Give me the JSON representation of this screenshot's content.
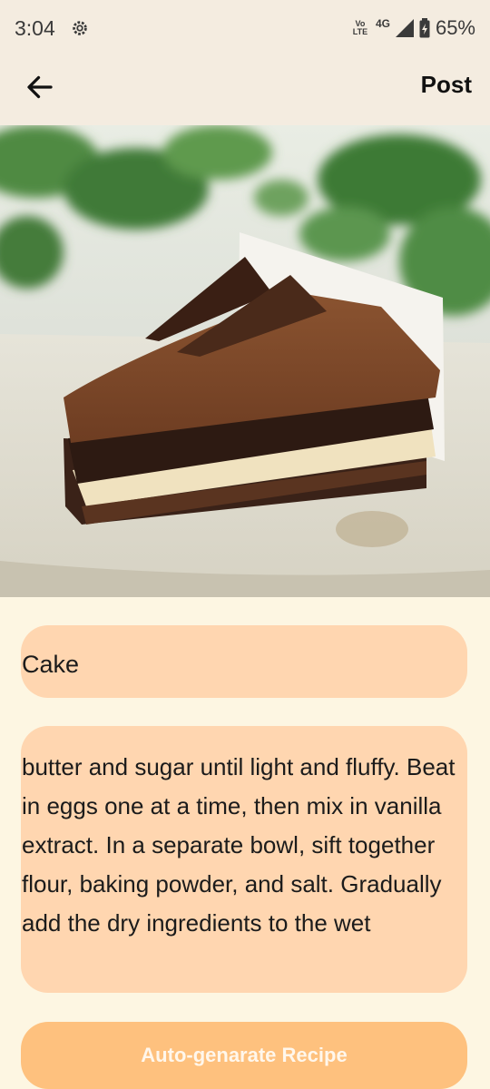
{
  "status_bar": {
    "time": "3:04",
    "network": "4G",
    "volte": "Vo LTE",
    "battery": "65%"
  },
  "top_bar": {
    "post_label": "Post"
  },
  "form": {
    "title_value": "Cake",
    "recipe_value": "butter and sugar until light and fluffy. Beat in eggs one at a time, then mix in vanilla extract. In a separate bowl, sift together flour, baking powder, and salt. Gradually add the dry ingredients to the wet"
  },
  "actions": {
    "generate_label": "Auto-genarate Recipe"
  },
  "colors": {
    "background": "#fdf6e2",
    "header": "#f4ece0",
    "field_fill": "#ffd6b0",
    "button_fill": "#fec17e"
  }
}
